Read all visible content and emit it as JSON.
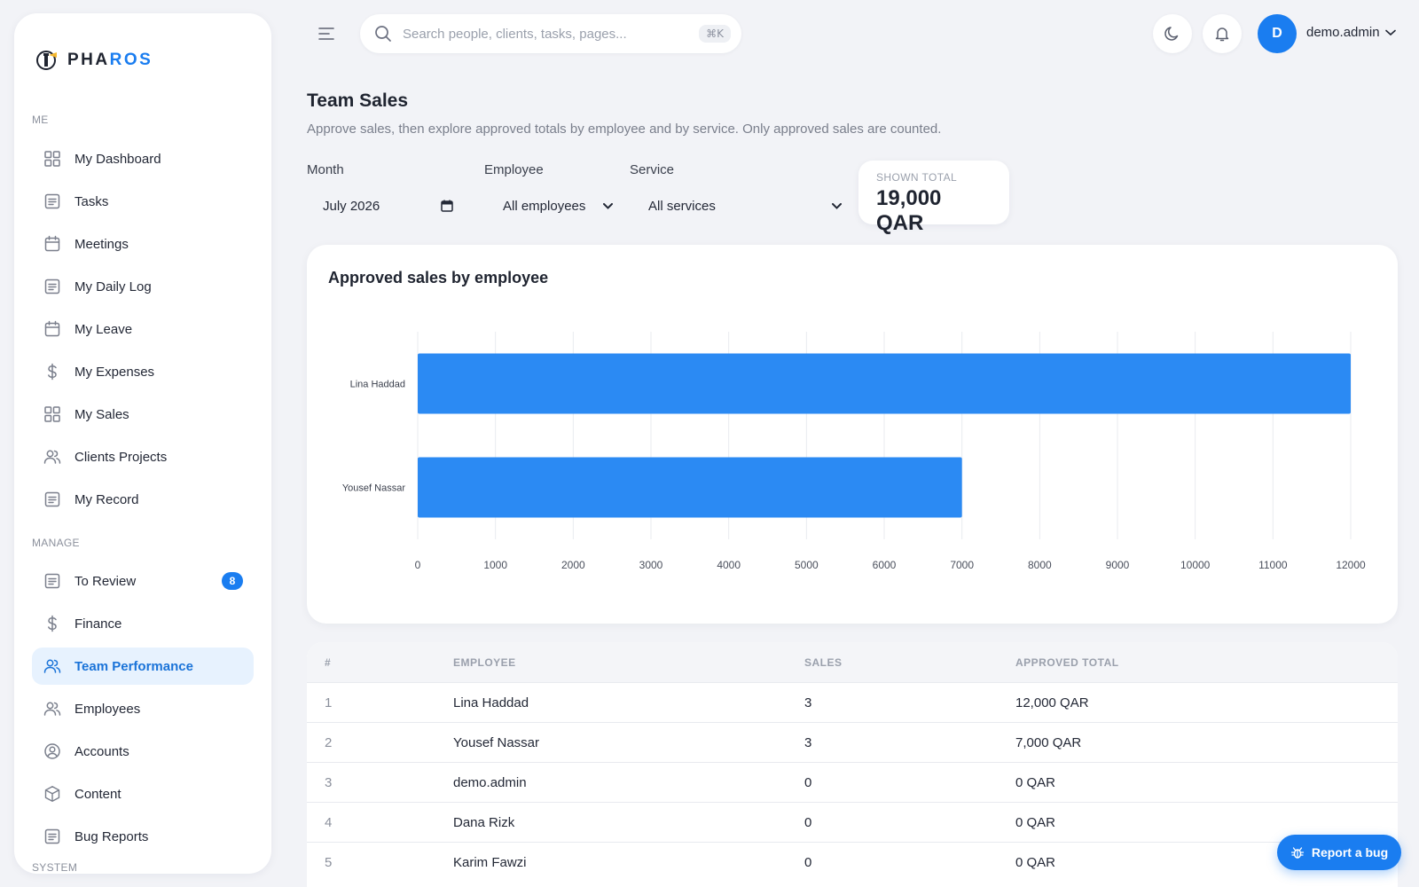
{
  "brand": {
    "name_part1": "PHA",
    "name_part2": "ROS"
  },
  "sidebar": {
    "sections": [
      {
        "label": "ME"
      },
      {
        "label": "MANAGE"
      },
      {
        "label": "SYSTEM"
      }
    ],
    "me_items": [
      {
        "label": "My Dashboard",
        "icon": "grid-icon"
      },
      {
        "label": "Tasks",
        "icon": "document-icon"
      },
      {
        "label": "Meetings",
        "icon": "calendar-icon"
      },
      {
        "label": "My Daily Log",
        "icon": "document-icon"
      },
      {
        "label": "My Leave",
        "icon": "calendar-icon"
      },
      {
        "label": "My Expenses",
        "icon": "dollar-icon"
      },
      {
        "label": "My Sales",
        "icon": "grid-icon"
      },
      {
        "label": "Clients Projects",
        "icon": "users-icon"
      },
      {
        "label": "My Record",
        "icon": "document-icon"
      }
    ],
    "manage_items": [
      {
        "label": "To Review",
        "icon": "document-icon",
        "badge": "8"
      },
      {
        "label": "Finance",
        "icon": "dollar-icon"
      },
      {
        "label": "Team Performance",
        "icon": "users-icon",
        "active": true
      },
      {
        "label": "Employees",
        "icon": "users-icon"
      },
      {
        "label": "Accounts",
        "icon": "user-circle-icon"
      },
      {
        "label": "Content",
        "icon": "box-icon"
      },
      {
        "label": "Bug Reports",
        "icon": "document-icon"
      }
    ]
  },
  "topbar": {
    "search_placeholder": "Search people, clients, tasks, pages...",
    "search_shortcut": "⌘K",
    "user_initial": "D",
    "user_name": "demo.admin"
  },
  "page": {
    "title": "Team Sales",
    "subtitle": "Approve sales, then explore approved totals by employee and by service. Only approved sales are counted."
  },
  "filters": {
    "month_label": "Month",
    "month_value": "July  2026",
    "employee_label": "Employee",
    "employee_value": "All employees",
    "service_label": "Service",
    "service_value": "All services"
  },
  "shown_total": {
    "label": "SHOWN TOTAL",
    "value": "19,000 QAR"
  },
  "chart_data": {
    "type": "bar",
    "orientation": "horizontal",
    "title": "Approved sales by employee",
    "categories": [
      "Lina Haddad",
      "Yousef Nassar"
    ],
    "values": [
      12000,
      7000
    ],
    "xlim": [
      0,
      12000
    ],
    "xticks": [
      0,
      1000,
      2000,
      3000,
      4000,
      5000,
      6000,
      7000,
      8000,
      9000,
      10000,
      11000,
      12000
    ],
    "grid": true,
    "color": "#2b8af3"
  },
  "table": {
    "headers": [
      "#",
      "EMPLOYEE",
      "SALES",
      "APPROVED TOTAL"
    ],
    "rows": [
      {
        "idx": "1",
        "employee": "Lina Haddad",
        "sales": "3",
        "total": "12,000 QAR"
      },
      {
        "idx": "2",
        "employee": "Yousef Nassar",
        "sales": "3",
        "total": "7,000 QAR"
      },
      {
        "idx": "3",
        "employee": "demo.admin",
        "sales": "0",
        "total": "0 QAR"
      },
      {
        "idx": "4",
        "employee": "Dana Rizk",
        "sales": "0",
        "total": "0 QAR"
      },
      {
        "idx": "5",
        "employee": "Karim Fawzi",
        "sales": "0",
        "total": "0 QAR"
      }
    ]
  },
  "report_bug": {
    "label": "Report a bug"
  }
}
